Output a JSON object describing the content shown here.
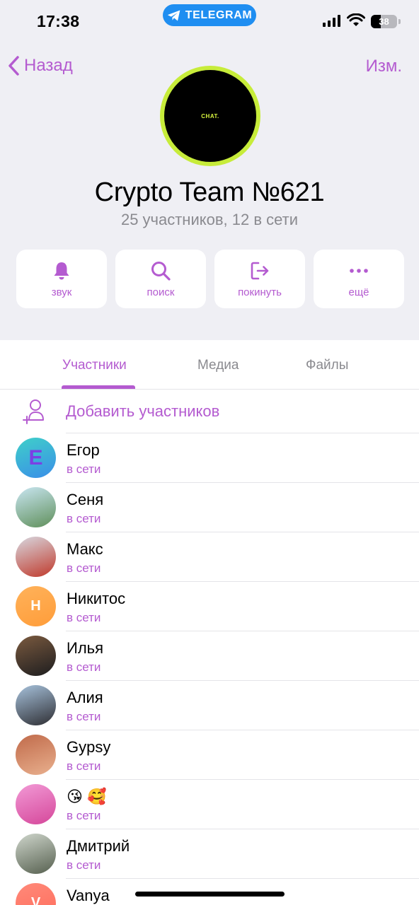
{
  "status_bar": {
    "time": "17:38",
    "app_pill": "TELEGRAM",
    "battery": "38",
    "battery_level": 0.38
  },
  "nav": {
    "back_label": "Назад",
    "edit_label": "Изм."
  },
  "group": {
    "avatar_text": "CHAT.",
    "name": "Crypto Team №621",
    "subtitle": "25 участников, 12 в сети"
  },
  "actions": [
    {
      "label": "звук",
      "icon": "bell-icon"
    },
    {
      "label": "поиск",
      "icon": "search-icon"
    },
    {
      "label": "покинуть",
      "icon": "leave-icon"
    },
    {
      "label": "ещё",
      "icon": "more-icon"
    }
  ],
  "tabs": [
    {
      "label": "Участники",
      "active": true
    },
    {
      "label": "Медиа",
      "active": false
    },
    {
      "label": "Файлы",
      "active": false
    }
  ],
  "add_members_label": "Добавить участников",
  "members": [
    {
      "name": "Егор",
      "status": "в сети",
      "avatar_letter": "E",
      "avatar_colors": [
        "#3fd0c9",
        "#3a8ee8"
      ],
      "letter_color": "#7b3fe4"
    },
    {
      "name": "Сеня",
      "status": "в сети",
      "avatar_letter": "",
      "avatar_colors": [
        "#c9e6f2",
        "#5f8f5a"
      ]
    },
    {
      "name": "Макс",
      "status": "в сети",
      "avatar_letter": "",
      "avatar_colors": [
        "#d8d8e0",
        "#c0392b"
      ]
    },
    {
      "name": "Никитос",
      "status": "в сети",
      "avatar_letter": "Н",
      "avatar_colors": [
        "#ffb25a",
        "#ff9d3a"
      ]
    },
    {
      "name": "Илья",
      "status": "в сети",
      "avatar_letter": "",
      "avatar_colors": [
        "#7b5a3f",
        "#1d1d1f"
      ]
    },
    {
      "name": "Алия",
      "status": "в сети",
      "avatar_letter": "",
      "avatar_colors": [
        "#a7c2dc",
        "#2e2e33"
      ]
    },
    {
      "name": "Gypsy",
      "status": "в сети",
      "avatar_letter": "",
      "avatar_colors": [
        "#c06a4a",
        "#e9b08e"
      ]
    },
    {
      "name": "😘 🥰",
      "status": "в сети",
      "avatar_letter": "",
      "avatar_colors": [
        "#f29ad6",
        "#d5479a"
      ]
    },
    {
      "name": "Дмитрий",
      "status": "в сети",
      "avatar_letter": "",
      "avatar_colors": [
        "#cfd6cc",
        "#56604f"
      ]
    },
    {
      "name": "Vanya",
      "status": "",
      "avatar_letter": "V",
      "avatar_colors": [
        "#ff8a7a",
        "#ff6b5a"
      ]
    }
  ],
  "colors": {
    "accent": "#b45bd0",
    "header_bg": "#efeff4",
    "secondary_text": "#8a8a8f"
  }
}
